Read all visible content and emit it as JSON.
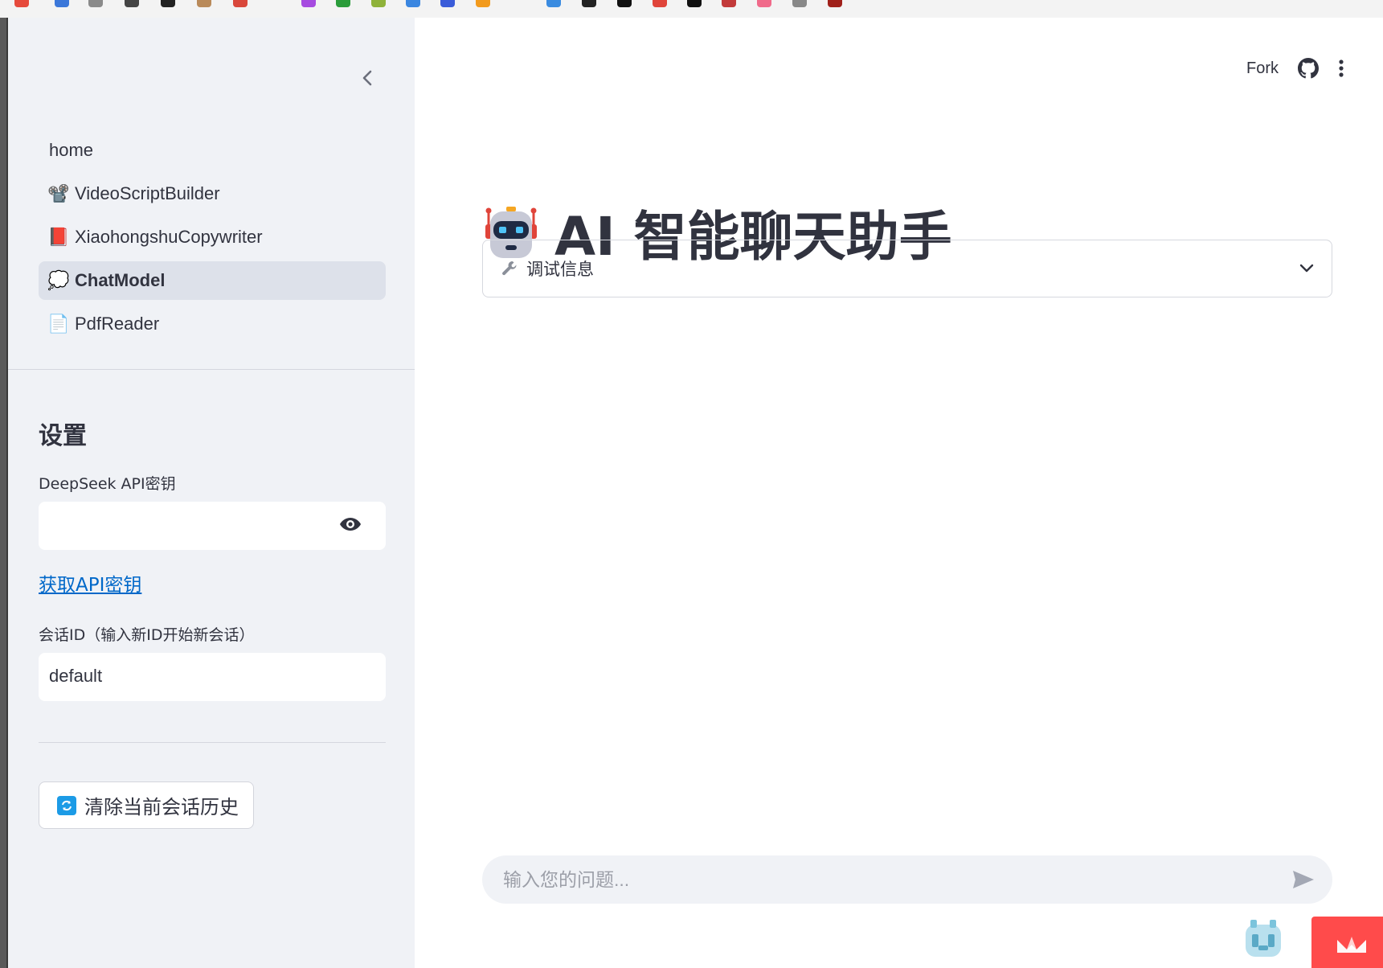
{
  "colors": {
    "sidebar_bg": "#f0f2f6",
    "active_nav_bg": "#dde1ea",
    "link": "#0068c9",
    "accent": "#ff4b4b",
    "text": "#31333f"
  },
  "sidebar": {
    "collapse_icon": "chevron-left-icon",
    "nav_items": [
      {
        "label": "home",
        "emoji": ""
      },
      {
        "label": "VideoScriptBuilder",
        "emoji": "📽️"
      },
      {
        "label": "XiaohongshuCopywriter",
        "emoji": "📕"
      },
      {
        "label": "ChatModel",
        "emoji": "💭",
        "active": true
      },
      {
        "label": "PdfReader",
        "emoji": "📄"
      }
    ],
    "settings": {
      "title": "设置",
      "api_key_label": "DeepSeek API密钥",
      "api_key_value": "",
      "get_key_link": "获取API密钥",
      "session_label": "会话ID（输入新ID开始新会话）",
      "session_value": "default",
      "clear_button_label": "清除当前会话历史",
      "clear_button_icon": "refresh-icon"
    }
  },
  "header": {
    "fork_label": "Fork",
    "github_icon": "github-icon",
    "menu_icon": "more-vertical-icon"
  },
  "main": {
    "title": "AI 智能聊天助手",
    "title_icon": "robot-icon",
    "expander_label": "调试信息",
    "expander_icon": "wrench-icon",
    "chat_placeholder": "输入您的问题..."
  }
}
